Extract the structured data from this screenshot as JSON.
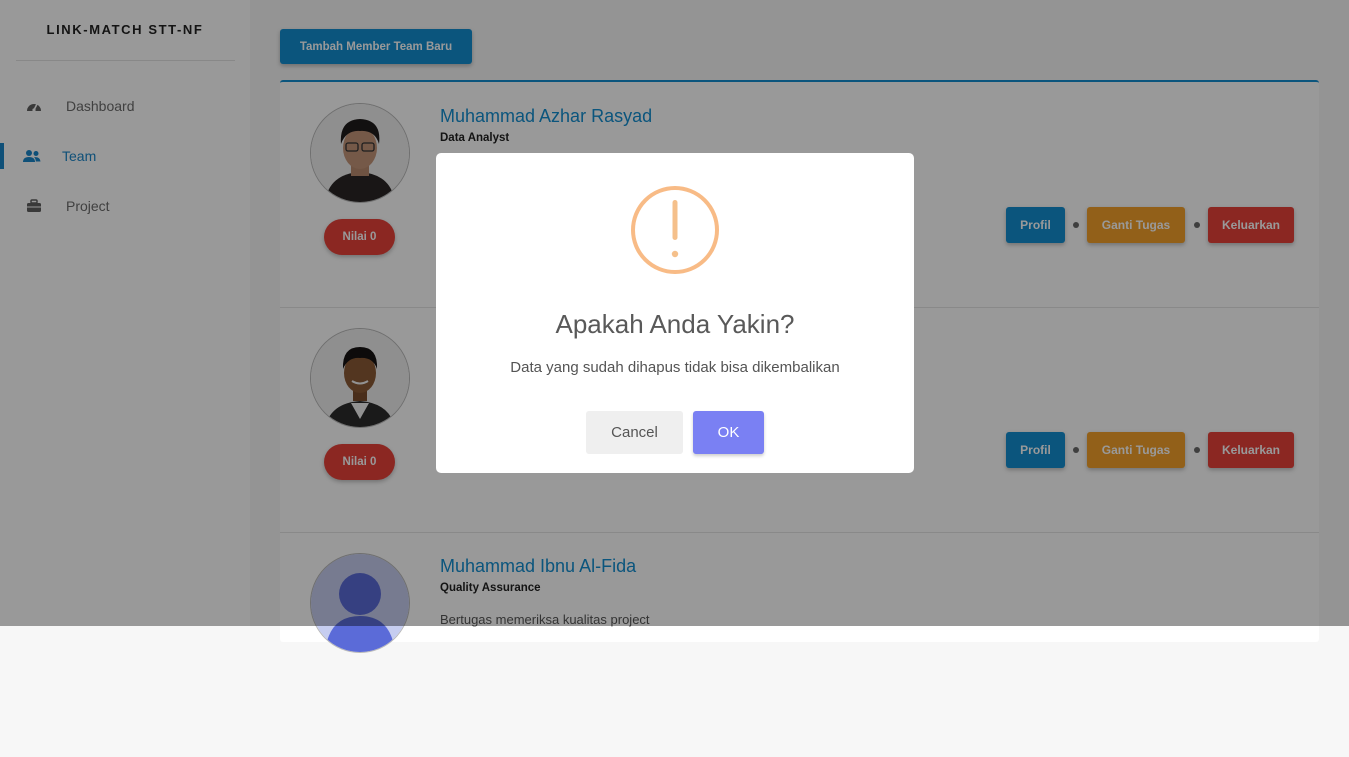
{
  "app": {
    "brand": "LINK-MATCH STT-NF"
  },
  "sidebar": {
    "items": [
      {
        "label": "Dashboard",
        "icon": "dashboard-gauge-icon",
        "active": false
      },
      {
        "label": "Team",
        "icon": "users-icon",
        "active": true
      },
      {
        "label": "Project",
        "icon": "briefcase-icon",
        "active": false
      }
    ]
  },
  "toolbar": {
    "add_member_label": "Tambah Member Team Baru"
  },
  "members": [
    {
      "name": "Muhammad Azhar Rasyad",
      "role": "Data Analyst",
      "score_label": "Nilai 0",
      "actions": {
        "profile": "Profil",
        "change_task": "Ganti Tugas",
        "remove": "Keluarkan"
      }
    },
    {
      "name": "",
      "role": "",
      "score_label": "Nilai 0",
      "actions": {
        "profile": "Profil",
        "change_task": "Ganti Tugas",
        "remove": "Keluarkan"
      }
    },
    {
      "name": "Muhammad Ibnu Al-Fida",
      "role": "Quality Assurance",
      "description": "Bertugas memeriksa kualitas project"
    }
  ],
  "dialog": {
    "icon": "warning-exclamation-icon",
    "title": "Apakah Anda Yakin?",
    "text": "Data yang sudah dihapus tidak bisa dikembalikan",
    "cancel_label": "Cancel",
    "ok_label": "OK"
  },
  "colors": {
    "primary": "#138ed0",
    "warning": "#f3a12b",
    "danger": "#e8413a",
    "confirm": "#7a80f3",
    "warning_icon": "#f8bb86"
  }
}
